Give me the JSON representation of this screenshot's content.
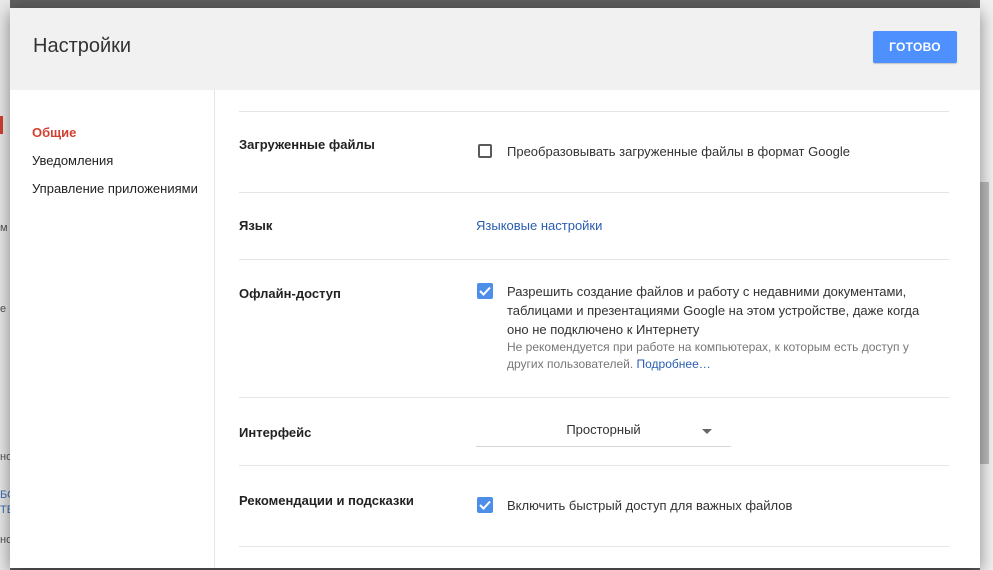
{
  "background": {
    "left_fragments": [
      "м",
      "е",
      "но",
      "БО",
      "ТЕ",
      "но"
    ],
    "colors": {
      "overlay": "#5f5f5f",
      "accent_red": "#d23f31"
    }
  },
  "dialog": {
    "title": "Настройки",
    "done_label": "ГОТОВО"
  },
  "sidebar": {
    "items": [
      {
        "label": "Общие",
        "active": true
      },
      {
        "label": "Уведомления",
        "active": false
      },
      {
        "label": "Управление приложениями",
        "active": false
      }
    ]
  },
  "settings": {
    "uploads": {
      "label": "Загруженные файлы",
      "option": "Преобразовывать загруженные файлы в формат Google",
      "checked": false
    },
    "language": {
      "label": "Язык",
      "link": "Языковые настройки"
    },
    "offline": {
      "label": "Офлайн-доступ",
      "option_lines": [
        "Разрешить создание файлов и работу с недавними документами,",
        "таблицами и презентациями Google на этом устройстве, даже когда",
        "оно не подключено к Интернету"
      ],
      "hint_line1": "Не рекомендуется при работе на компьютерах, к которым есть доступ у",
      "hint_line2": "других пользователей.",
      "hint_link": "Подробнее…",
      "checked": true
    },
    "interface": {
      "label": "Интерфейс",
      "selected": "Просторный"
    },
    "suggestions": {
      "label": "Рекомендации и подсказки",
      "option": "Включить быстрый доступ для важных файлов",
      "checked": true
    }
  },
  "icons": {
    "checkmark": "checkmark-icon",
    "dropdown": "caret-down-icon"
  },
  "colors": {
    "primary_button": "#4d90fe",
    "checkbox_checked": "#4d8fe8",
    "link": "#2a5db0",
    "active_nav": "#d23f31"
  }
}
